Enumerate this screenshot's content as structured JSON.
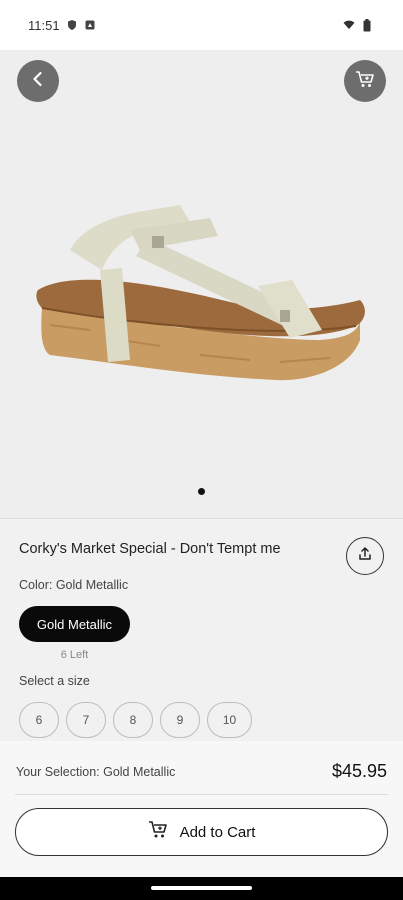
{
  "status_bar": {
    "time": "11:51"
  },
  "product": {
    "title": "Corky's Market Special - Don't Tempt me",
    "color_label": "Color: Gold Metallic",
    "selected_color": "Gold Metallic",
    "stock_left": "6 Left",
    "size_label": "Select a size",
    "sizes": [
      "6",
      "7",
      "8",
      "9",
      "10"
    ]
  },
  "footer": {
    "selection_text": "Your Selection: Gold Metallic",
    "price": "$45.95",
    "add_to_cart_label": "Add to Cart"
  },
  "icons": [
    "back-arrow-icon",
    "cart-icon",
    "share-icon",
    "wifi-icon",
    "battery-icon",
    "shield-icon"
  ]
}
